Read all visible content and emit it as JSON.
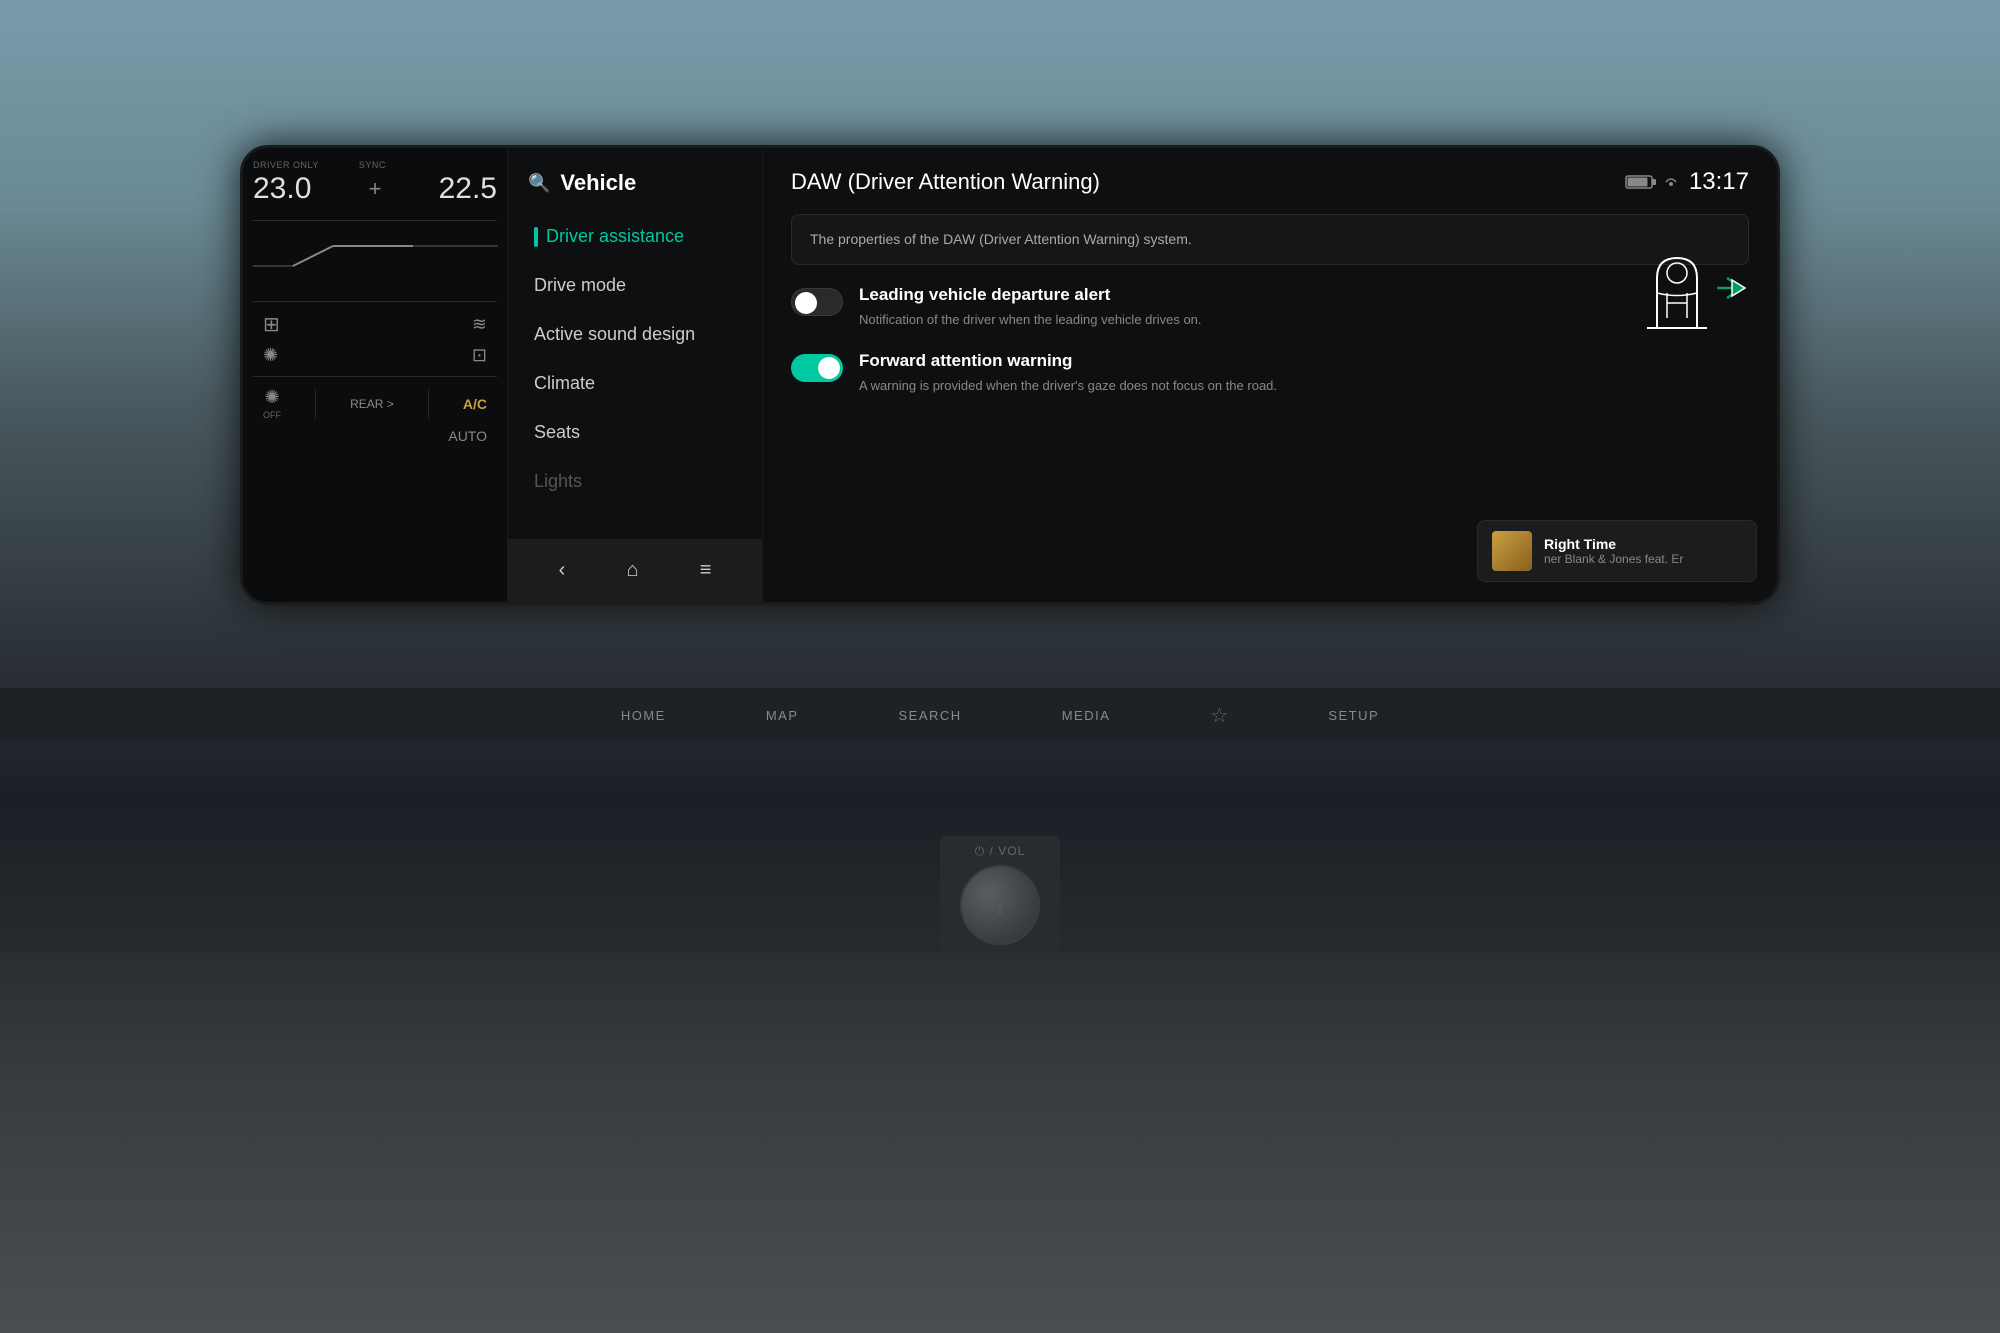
{
  "screen": {
    "title": "DAW (Driver Attention Warning)",
    "description": "The properties of the DAW (Driver Attention Warning) system.",
    "time": "13:17"
  },
  "menu": {
    "header": "Vehicle",
    "items": [
      {
        "label": "Driver assistance",
        "active": true
      },
      {
        "label": "Drive mode",
        "active": false
      },
      {
        "label": "Active sound design",
        "active": false
      },
      {
        "label": "Climate",
        "active": false
      },
      {
        "label": "Seats",
        "active": false
      },
      {
        "label": "Lights",
        "active": false
      }
    ]
  },
  "settings": [
    {
      "id": "leading-vehicle",
      "title": "Leading vehicle departure alert",
      "description": "Notification of the driver when the leading vehicle drives on.",
      "enabled": false
    },
    {
      "id": "forward-attention",
      "title": "Forward attention warning",
      "description": "A warning is provided when the driver's gaze does not focus on the road.",
      "enabled": true
    }
  ],
  "climate": {
    "driver_label": "DRIVER ONLY",
    "sync_label": "SYNC",
    "temp_driver": "23.0",
    "temp_sync": "22.5",
    "rear_label": "REAR >",
    "ac_label": "A/C",
    "auto_label": "AUTO"
  },
  "music": {
    "title": "Right Time",
    "artist": "ner  Blank & Jones feat. Er"
  },
  "nav": {
    "back": "‹",
    "home": "⌂",
    "menu": "≡"
  },
  "bottom_nav": {
    "home": "HOME",
    "map": "MAP",
    "search": "SEARCH",
    "media": "MEDIA",
    "setup": "SETUP"
  },
  "knob": {
    "label": "⏻ / VOL"
  }
}
